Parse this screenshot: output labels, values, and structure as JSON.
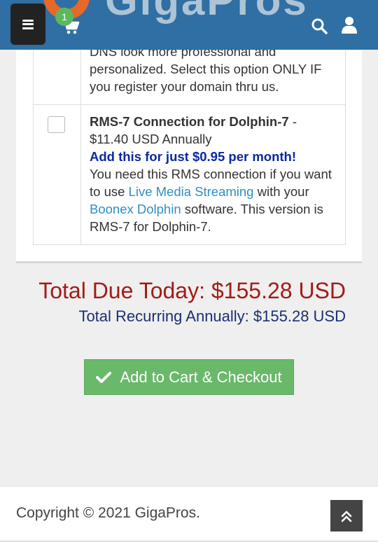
{
  "header": {
    "logo_text": "GigaPros",
    "cart_count": "1"
  },
  "addons": [
    {
      "description_tail": "DNS look more professional and personalized. Select this option ONLY IF you register your domain thru us."
    },
    {
      "name": "RMS-7 Connection for Dolphin-7",
      "name_separator": " -",
      "price": "$11.40 USD Annually",
      "promo": "Add this for just $0.95 per month!",
      "desc_part1": "You need this RMS connection if you want to use ",
      "link1": "Live Media Streaming",
      "desc_part2": " with your ",
      "link2": "Boonex Dolphin",
      "desc_part3": " software. This version is RMS-7 for Dolphin-7.",
      "checked": false
    }
  ],
  "totals": {
    "due_today": "Total Due Today: $155.28 USD",
    "recurring": "Total Recurring Annually: $155.28 USD"
  },
  "checkout": {
    "label": "Add to Cart & Checkout"
  },
  "footer": {
    "copyright": "Copyright © 2021 GigaPros."
  },
  "colors": {
    "header_bg": "#2f6fa4",
    "total_due": "#a31b17",
    "recurring": "#1b2f73",
    "promo": "#0a28a0",
    "link": "#2f8fc5",
    "checkout_bg": "#6ab86a",
    "badge": "#5cb85c"
  },
  "icons": [
    "menu-icon",
    "cart-icon",
    "search-icon",
    "user-icon",
    "check-icon",
    "chevron-double-up-icon"
  ]
}
